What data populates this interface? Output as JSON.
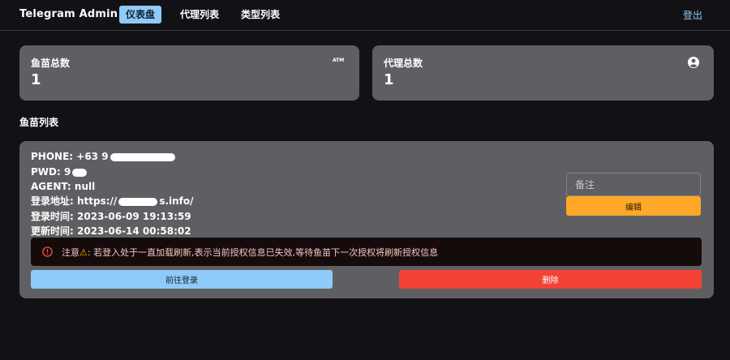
{
  "navbar": {
    "brand": "Telegram Admin",
    "tabs": [
      {
        "label": "仪表盘",
        "active": true
      },
      {
        "label": "代理列表",
        "active": false
      },
      {
        "label": "类型列表",
        "active": false
      }
    ],
    "logout": "登出"
  },
  "stats": [
    {
      "title": "鱼苗总数",
      "value": "1",
      "icon": "atm-icon"
    },
    {
      "title": "代理总数",
      "value": "1",
      "icon": "account-circle-icon"
    }
  ],
  "section_title": "鱼苗列表",
  "record": {
    "phone_label": "PHONE:",
    "phone_visible": "+63 9",
    "pwd_label": "PWD:",
    "pwd_visible": "9",
    "agent_label": "AGENT:",
    "agent_value": "null",
    "login_url_label": "登录地址:",
    "login_url_prefix": "https://",
    "login_url_suffix": "s.info/",
    "login_time_label": "登录时间:",
    "login_time_value": "2023-06-09 19:13:59",
    "update_time_label": "更新时间:",
    "update_time_value": "2023-06-14 00:58:02"
  },
  "note": {
    "placeholder": "备注"
  },
  "buttons": {
    "edit": "编辑",
    "goto_login": "前往登录",
    "delete": "删除"
  },
  "alert": {
    "prefix": "注意",
    "warn_glyph": "⚠",
    "message": ": 若登入处于一直加载刷新,表示当前授权信息已失效,等待鱼苗下一次授权将刷新授权信息"
  },
  "colors": {
    "background": "#121216",
    "card": "#5f5f63",
    "primary": "#90caf9",
    "warning": "#ffa726",
    "error": "#f44336"
  }
}
